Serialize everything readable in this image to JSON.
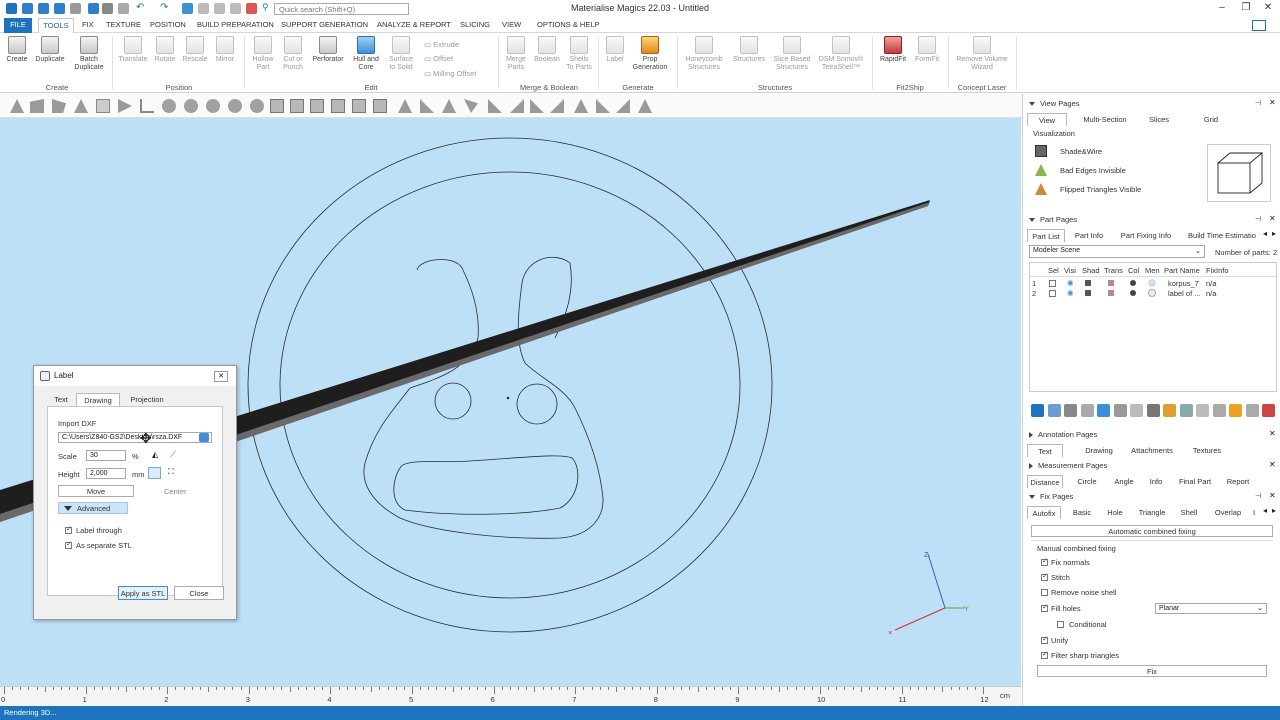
{
  "app": {
    "title": "Materialise Magics 22.03 - Untitled",
    "search_placeholder": "Quick search (Shift+Q)"
  },
  "menu": {
    "file": "FILE",
    "items": [
      "TOOLS",
      "FIX",
      "TEXTURE",
      "POSITION",
      "BUILD PREPARATION",
      "SUPPORT GENERATION",
      "ANALYZE & REPORT",
      "SLICING",
      "VIEW",
      "OPTIONS & HELP"
    ]
  },
  "ribbon": {
    "create": {
      "label": "Create",
      "buttons": [
        "Create",
        "Duplicate",
        "Batch\nDuplicate"
      ]
    },
    "position": {
      "label": "Position",
      "buttons": [
        "Translate",
        "Rotate",
        "Rescale",
        "Mirror"
      ]
    },
    "edit": {
      "label": "Edit",
      "buttons": [
        "Hollow\nPart",
        "Cut or\nPunch",
        "Perforator",
        "Hull and\nCore",
        "Surface\nto Solid"
      ],
      "small": [
        "Extrude",
        "Offset",
        "Milling Offset"
      ]
    },
    "merge": {
      "label": "Merge & Boolean",
      "buttons": [
        "Merge\nParts",
        "Boolean",
        "Shells\nTo Parts"
      ]
    },
    "generate": {
      "label": "Generate",
      "buttons": [
        "Label",
        "Prop\nGeneration"
      ]
    },
    "structures": {
      "label": "Structures",
      "buttons": [
        "Honeycomb\nStructures",
        "Structures",
        "Slice Based\nStructures",
        "DSM Somos®\nTetraShell™"
      ]
    },
    "fit2ship": {
      "label": "Fit2Ship",
      "buttons": [
        "RapidFit",
        "FormFit"
      ]
    },
    "concept": {
      "label": "Concept Laser",
      "buttons": [
        "Remove Volume\nWizard"
      ]
    }
  },
  "ruler": {
    "ticks": [
      "0",
      "1",
      "2",
      "3",
      "4",
      "5",
      "6",
      "7",
      "8",
      "9",
      "10",
      "11",
      "12"
    ],
    "unit": "cm"
  },
  "status": "Rendering 3D...",
  "dialog": {
    "title": "Label",
    "tabs": [
      "Text",
      "Drawing",
      "Projection"
    ],
    "import_label": "Import DXF",
    "path": "C:\\Users\\Z840-GS2\\Desktop\\rsza.DXF",
    "scale_label": "Scale",
    "scale_value": "30",
    "scale_unit": "%",
    "height_label": "Height",
    "height_value": "2,000",
    "height_unit": "mm",
    "move": "Move",
    "center": "Center",
    "advanced": "Advanced",
    "label_through": "Label through",
    "separate_stl": "As separate STL",
    "apply": "Apply as STL",
    "close": "Close"
  },
  "view_pages": {
    "title": "View Pages",
    "tabs": [
      "View",
      "Multi-Section",
      "Slices",
      "Grid"
    ],
    "visualization": "Visualization",
    "options": [
      "Shade&Wire",
      "Bad Edges Invisible",
      "Flipped Triangles Visible"
    ]
  },
  "part_pages": {
    "title": "Part Pages",
    "tabs": [
      "Part List",
      "Part Info",
      "Part Fixing Info",
      "Build Time Estimatio"
    ],
    "scene": "Modeler Scene",
    "num_parts_label": "Number of parts:",
    "num_parts": "2",
    "columns": [
      "Sel",
      "Visi",
      "Shad",
      "Trans",
      "Col",
      "Men",
      "Part Name",
      "FixInfo"
    ],
    "rows": [
      {
        "idx": "1",
        "name": "korpus_7",
        "fix": "n/a"
      },
      {
        "idx": "2",
        "name": "label of ...",
        "fix": "n/a"
      }
    ]
  },
  "annotation_pages": {
    "title": "Annotation Pages",
    "tabs": [
      "Text",
      "Drawing",
      "Attachments",
      "Textures"
    ]
  },
  "measurement_pages": {
    "title": "Measurement Pages",
    "tabs": [
      "Distance",
      "Circle",
      "Angle",
      "Info",
      "Final Part",
      "Report"
    ]
  },
  "fix_pages": {
    "title": "Fix Pages",
    "tabs": [
      "Autofix",
      "Basic",
      "Hole",
      "Triangle",
      "Shell",
      "Overlap",
      "I"
    ],
    "auto_button": "Automatic combined fixing",
    "manual_label": "Manual combined fixing",
    "items": [
      {
        "label": "Fix normals",
        "checked": true
      },
      {
        "label": "Stitch",
        "checked": true
      },
      {
        "label": "Remove noise shell",
        "checked": false
      },
      {
        "label": "Fill holes",
        "checked": true
      }
    ],
    "fill_mode": "Planar",
    "conditional": "Conditional",
    "items2": [
      {
        "label": "Unify",
        "checked": true
      },
      {
        "label": "Filter sharp triangles",
        "checked": true
      }
    ],
    "fix_button": "Fix"
  },
  "axes": {
    "z": "Z",
    "y": "Y"
  },
  "colors": {
    "accent": "#1e73be",
    "viewport": "#bee0f7"
  }
}
